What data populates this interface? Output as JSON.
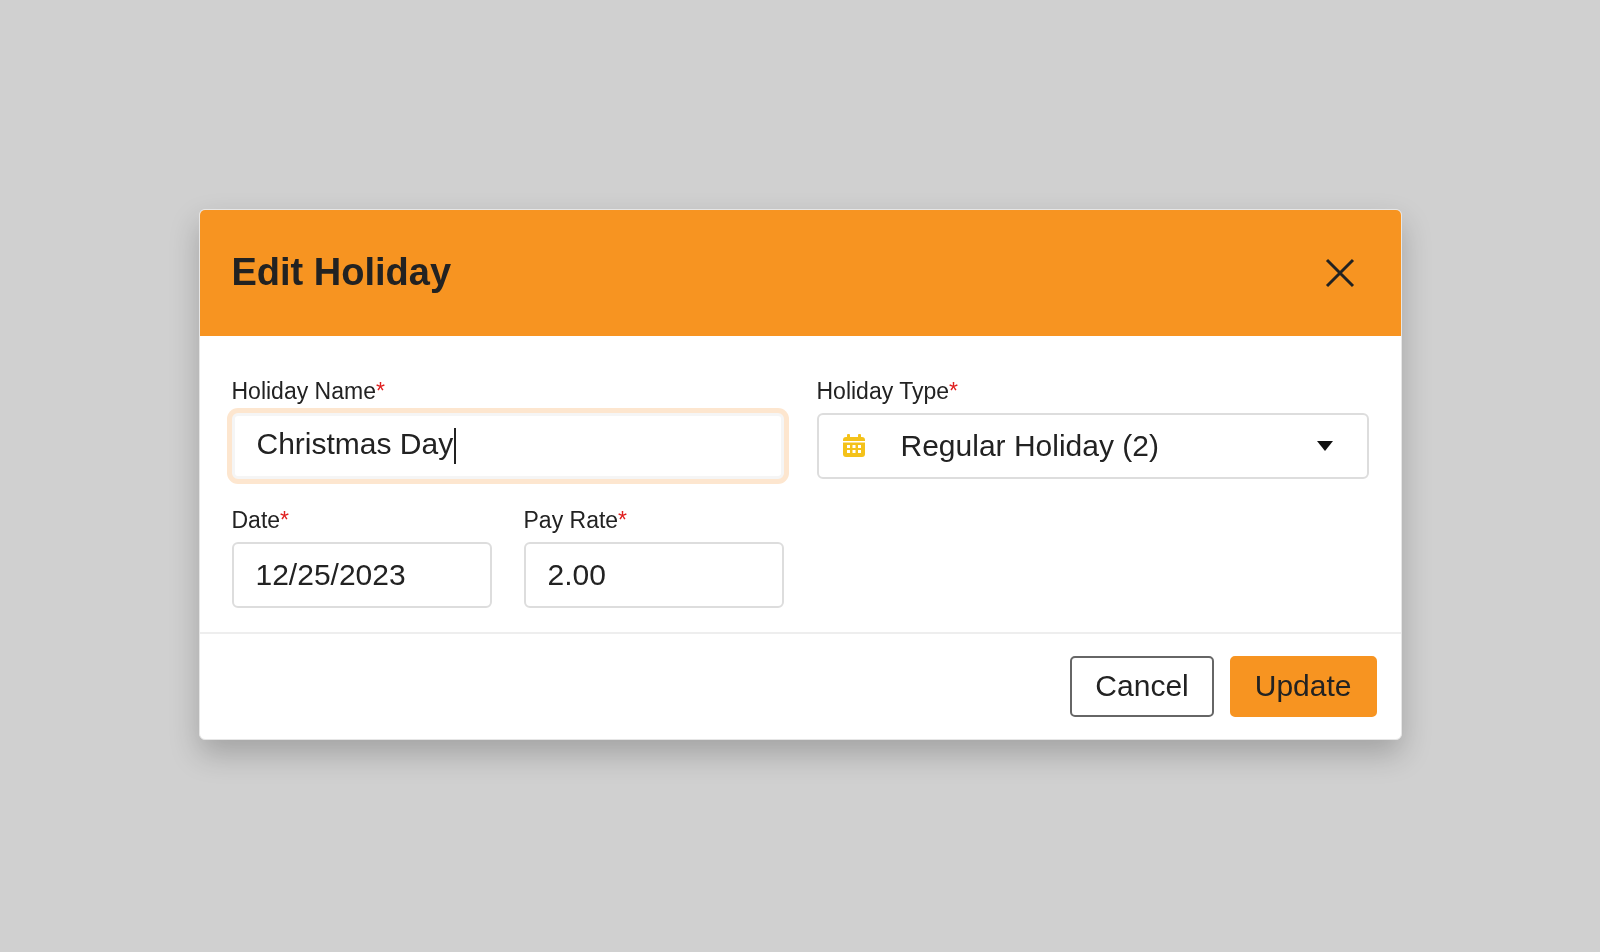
{
  "dialog": {
    "title": "Edit Holiday"
  },
  "fields": [
    {
      "kind": "text",
      "label": "Holiday Name",
      "required_mark": "*",
      "value": "Christmas Day",
      "focused": true
    },
    {
      "kind": "select",
      "label": "Holiday Type",
      "required_mark": "*",
      "value": "Regular Holiday (2)",
      "focused": false
    },
    {
      "kind": "text",
      "label": "Date",
      "required_mark": "*",
      "value": "12/25/2023",
      "focused": false
    },
    {
      "kind": "text",
      "label": "Pay Rate",
      "required_mark": "*",
      "value": "2.00",
      "focused": false
    }
  ],
  "buttons": [
    {
      "label": "Cancel",
      "kind": "secondary"
    },
    {
      "label": "Update",
      "kind": "primary"
    }
  ]
}
